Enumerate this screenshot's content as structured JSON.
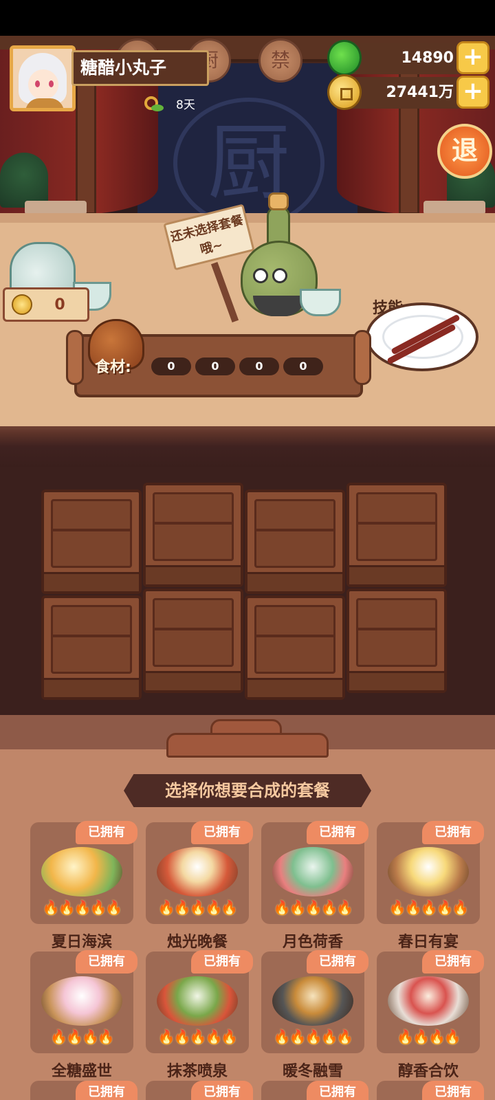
{
  "player": {
    "name": "糖醋小丸子",
    "days": "8天"
  },
  "currencies": {
    "jade": "14890",
    "coins": "27441万"
  },
  "exit_label": "退",
  "stage": {
    "emblem": "厨",
    "plaques": [
      "",
      "厨",
      "禁"
    ]
  },
  "counter": {
    "wine_price": "0",
    "sign_text": "还未选择套餐哦~",
    "skill_label": "技能:",
    "ingredients_label": "食材:",
    "ingredient_counts": [
      "0",
      "0",
      "0",
      "0"
    ]
  },
  "panel": {
    "title": "选择你想要合成的套餐",
    "owned_label": "已拥有",
    "flames": "🔥🔥🔥🔥🔥",
    "flames_4": "🔥🔥🔥🔥",
    "meals": [
      {
        "name": "夏日海滨"
      },
      {
        "name": "烛光晚餐"
      },
      {
        "name": "月色荷香"
      },
      {
        "name": "春日有宴"
      },
      {
        "name": "全糖盛世"
      },
      {
        "name": "抹茶喷泉"
      },
      {
        "name": "暖冬融雪"
      },
      {
        "name": "醇香合饮"
      }
    ]
  }
}
